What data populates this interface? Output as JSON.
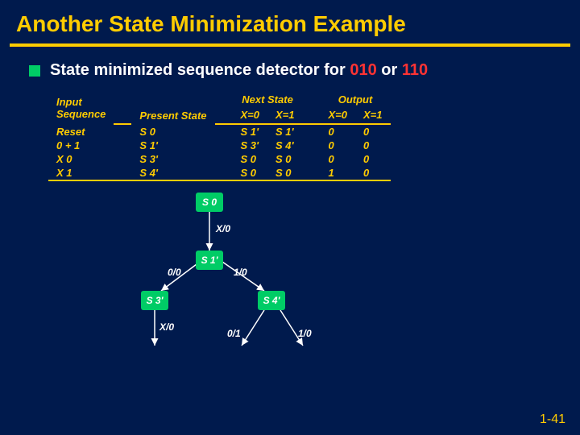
{
  "title": "Another State Minimization Example",
  "bullet": {
    "prefix": "State minimized sequence detector for ",
    "seq1": "010",
    "mid": " or ",
    "seq2": "110"
  },
  "table": {
    "headers": {
      "input_sequence": "Input\nSequence",
      "present_state": "Present State",
      "next_state": "Next State",
      "output": "Output",
      "x0": "X=0",
      "x1": "X=1"
    },
    "rows": [
      {
        "seq": "Reset",
        "ps": "S 0",
        "ns0": "S 1'",
        "ns1": "S 1'",
        "o0": "0",
        "o1": "0"
      },
      {
        "seq": "0 + 1",
        "ps": "S 1'",
        "ns0": "S 3'",
        "ns1": "S 4'",
        "o0": "0",
        "o1": "0"
      },
      {
        "seq": "X 0",
        "ps": "S 3'",
        "ns0": "S 0",
        "ns1": "S 0",
        "o0": "0",
        "o1": "0"
      },
      {
        "seq": "X 1",
        "ps": "S 4'",
        "ns0": "S 0",
        "ns1": "S 0",
        "o0": "1",
        "o1": "0"
      }
    ]
  },
  "diagram": {
    "states": {
      "s0": "S 0",
      "s1": "S 1'",
      "s3": "S 3'",
      "s4": "S 4'"
    },
    "edges": {
      "s0_s1": "X/0",
      "s1_s3": "0/0",
      "s1_s4": "1/0",
      "s3_out": "X/0",
      "s4_out0": "0/1",
      "s4_out1": "1/0"
    }
  },
  "slide_number": "1-41"
}
